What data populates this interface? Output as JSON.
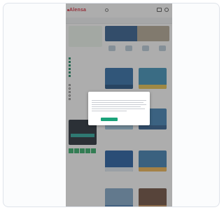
{
  "header": {
    "logo_text": "Alensa",
    "phone_text": "",
    "nav_items": [
      "",
      "",
      "",
      "",
      ""
    ]
  },
  "promo": {
    "text": ""
  },
  "categories": [
    "",
    "",
    "",
    ""
  ],
  "sidebar": {
    "filter_heading": "",
    "filter_items": [
      "",
      "",
      "",
      "",
      "",
      ""
    ],
    "second_heading": "",
    "second_items": [
      "",
      "",
      "",
      "",
      ""
    ],
    "promo_box_text": "",
    "trust_heading": ""
  },
  "products": [
    {
      "name": "",
      "price": "",
      "color": "#2a6aa5",
      "stripe": "#1b4c7f"
    },
    {
      "name": "",
      "price": "",
      "color": "#3a8fb8",
      "stripe": "#e7c24a"
    },
    {
      "name": "",
      "price": "",
      "color": "#2f78a8",
      "stripe": "#9cc5dd"
    },
    {
      "name": "",
      "price": "",
      "color": "#3b7fb3",
      "stripe": "#2c5c8e"
    },
    {
      "name": "",
      "price": "",
      "color": "#1e5aa0",
      "stripe": "#dfe8f2"
    },
    {
      "name": "",
      "price": "",
      "color": "#3a7cb0",
      "stripe": "#f0b34c"
    },
    {
      "name": "",
      "price": "",
      "color": "#7fa6c8",
      "stripe": "#4a7db2"
    },
    {
      "name": "",
      "price": "",
      "color": "#6b4a3a",
      "stripe": "#c38c55"
    }
  ],
  "cookie_dialog": {
    "title": "",
    "accept_label": "",
    "settings_label": ""
  },
  "colors": {
    "brand": "#d6293a",
    "accent": "#1aa37a",
    "overlay": "rgba(60,60,60,0.42)"
  }
}
